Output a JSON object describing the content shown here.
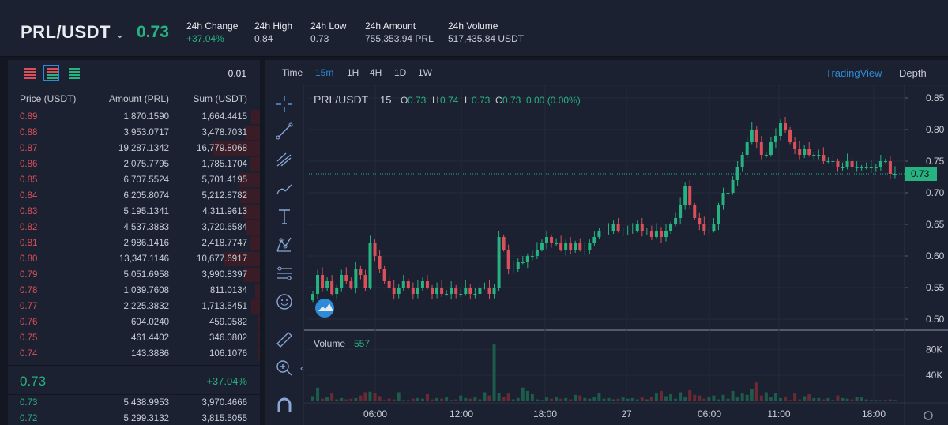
{
  "header": {
    "pair": "PRL/USDT",
    "last_price": "0.73",
    "stats": [
      {
        "label": "24h Change",
        "value": "+37.04%",
        "up": true
      },
      {
        "label": "24h High",
        "value": "0.84",
        "up": false
      },
      {
        "label": "24h Low",
        "value": "0.73",
        "up": false
      },
      {
        "label": "24h Amount",
        "value": "755,353.94 PRL",
        "up": false
      },
      {
        "label": "24h Volume",
        "value": "517,435.84 USDT",
        "up": false
      }
    ]
  },
  "orderbook": {
    "precision": "0.01",
    "columns": {
      "price": "Price (USDT)",
      "amount": "Amount (PRL)",
      "sum": "Sum (USDT)"
    },
    "asks": [
      {
        "price": "0.89",
        "amount": "1,870.1590",
        "sum": "1,664.4415"
      },
      {
        "price": "0.88",
        "amount": "3,953.0717",
        "sum": "3,478.7031"
      },
      {
        "price": "0.87",
        "amount": "19,287.1342",
        "sum": "16,779.8068"
      },
      {
        "price": "0.86",
        "amount": "2,075.7795",
        "sum": "1,785.1704"
      },
      {
        "price": "0.85",
        "amount": "6,707.5524",
        "sum": "5,701.4195"
      },
      {
        "price": "0.84",
        "amount": "6,205.8074",
        "sum": "5,212.8782"
      },
      {
        "price": "0.83",
        "amount": "5,195.1341",
        "sum": "4,311.9613"
      },
      {
        "price": "0.82",
        "amount": "4,537.3883",
        "sum": "3,720.6584"
      },
      {
        "price": "0.81",
        "amount": "2,986.1416",
        "sum": "2,418.7747"
      },
      {
        "price": "0.80",
        "amount": "13,347.1146",
        "sum": "10,677.6917"
      },
      {
        "price": "0.79",
        "amount": "5,051.6958",
        "sum": "3,990.8397"
      },
      {
        "price": "0.78",
        "amount": "1,039.7608",
        "sum": "811.0134"
      },
      {
        "price": "0.77",
        "amount": "2,225.3832",
        "sum": "1,713.5451"
      },
      {
        "price": "0.76",
        "amount": "604.0240",
        "sum": "459.0582"
      },
      {
        "price": "0.75",
        "amount": "461.4402",
        "sum": "346.0802"
      },
      {
        "price": "0.74",
        "amount": "143.3886",
        "sum": "106.1076"
      }
    ],
    "mid_price": "0.73",
    "mid_change": "+37.04%",
    "bids": [
      {
        "price": "0.73",
        "amount": "5,438.9953",
        "sum": "3,970.4666"
      },
      {
        "price": "0.72",
        "amount": "5,299.3132",
        "sum": "3,815.5055"
      }
    ]
  },
  "chart_toolbar": {
    "time_label": "Time",
    "intervals": [
      "15m",
      "1H",
      "4H",
      "1D",
      "1W"
    ],
    "active_interval": "15m",
    "tradingview": "TradingView",
    "depth": "Depth"
  },
  "chart_data": {
    "type": "candlestick",
    "legend": {
      "symbol": "PRL/USDT",
      "interval": "15",
      "o_label": "O",
      "o": "0.73",
      "h_label": "H",
      "h": "0.74",
      "l_label": "L",
      "l": "0.73",
      "c_label": "C",
      "c": "0.73",
      "chg": "0.00 (0.00%)"
    },
    "price_ticks": [
      "0.85",
      "0.80",
      "0.75",
      "0.70",
      "0.65",
      "0.60",
      "0.55",
      "0.50"
    ],
    "price_range": [
      0.485,
      0.87
    ],
    "last_price_label": "0.73",
    "volume_label": "Volume",
    "volume_value": "557",
    "volume_ticks": [
      "80K",
      "40K"
    ],
    "volume_max": 95000,
    "time_labels": [
      "06:00",
      "12:00",
      "18:00",
      "27",
      "06:00",
      "11:00",
      "18:00"
    ],
    "colors": {
      "up": "#27b282",
      "down": "#d9505a",
      "up_vol": "#1d5b4a",
      "down_vol": "#6b2a33"
    },
    "path": [
      0.54,
      0.57,
      0.55,
      0.56,
      0.54,
      0.55,
      0.57,
      0.56,
      0.55,
      0.58,
      0.57,
      0.55,
      0.62,
      0.6,
      0.58,
      0.56,
      0.55,
      0.54,
      0.55,
      0.56,
      0.55,
      0.54,
      0.55,
      0.56,
      0.55,
      0.54,
      0.55,
      0.54,
      0.54,
      0.55,
      0.54,
      0.54,
      0.55,
      0.54,
      0.54,
      0.55,
      0.55,
      0.54,
      0.55,
      0.63,
      0.61,
      0.58,
      0.58,
      0.59,
      0.59,
      0.6,
      0.6,
      0.61,
      0.62,
      0.63,
      0.62,
      0.62,
      0.61,
      0.62,
      0.61,
      0.62,
      0.61,
      0.61,
      0.62,
      0.63,
      0.64,
      0.64,
      0.64,
      0.65,
      0.64,
      0.64,
      0.64,
      0.64,
      0.65,
      0.64,
      0.64,
      0.63,
      0.64,
      0.63,
      0.64,
      0.65,
      0.66,
      0.68,
      0.71,
      0.68,
      0.66,
      0.65,
      0.64,
      0.64,
      0.65,
      0.68,
      0.7,
      0.7,
      0.72,
      0.74,
      0.76,
      0.78,
      0.8,
      0.78,
      0.76,
      0.76,
      0.78,
      0.79,
      0.81,
      0.8,
      0.78,
      0.77,
      0.76,
      0.77,
      0.76,
      0.76,
      0.76,
      0.75,
      0.75,
      0.75,
      0.74,
      0.74,
      0.75,
      0.74,
      0.74,
      0.74,
      0.74,
      0.74,
      0.74,
      0.75,
      0.75,
      0.73,
      0.73
    ],
    "volumes": [
      8000,
      21000,
      4000,
      6000,
      12000,
      3000,
      5000,
      3000,
      4000,
      5000,
      9000,
      14000,
      15000,
      13000,
      8000,
      2000,
      4000,
      3000,
      14000,
      2000,
      2000,
      4000,
      5000,
      4000,
      11000,
      3000,
      5000,
      4000,
      6000,
      2000,
      3000,
      9000,
      5000,
      4000,
      6000,
      3000,
      14000,
      9000,
      88000,
      13000,
      6000,
      12000,
      3000,
      5000,
      21000,
      16000,
      11000,
      3000,
      2000,
      6000,
      4000,
      6000,
      4000,
      5000,
      3000,
      10000,
      9000,
      5000,
      4000,
      6000,
      13000,
      4000,
      5000,
      3000,
      4000,
      6000,
      4000,
      5000,
      3000,
      6000,
      3000,
      7000,
      12000,
      16000,
      8000,
      11000,
      4000,
      14000,
      6000,
      17000,
      10000,
      9000,
      4000,
      7000,
      9000,
      3000,
      10000,
      4000,
      16000,
      6000,
      12000,
      10000,
      19000,
      29000,
      9000,
      14000,
      6000,
      13000,
      5000,
      6000,
      2000,
      13000,
      3000,
      8000,
      11000,
      5000,
      5000,
      3000,
      5000,
      2000,
      9000,
      5000,
      4000,
      3000,
      7000,
      6000,
      3000,
      2000,
      2000,
      2000,
      2000,
      3000,
      2000
    ]
  }
}
